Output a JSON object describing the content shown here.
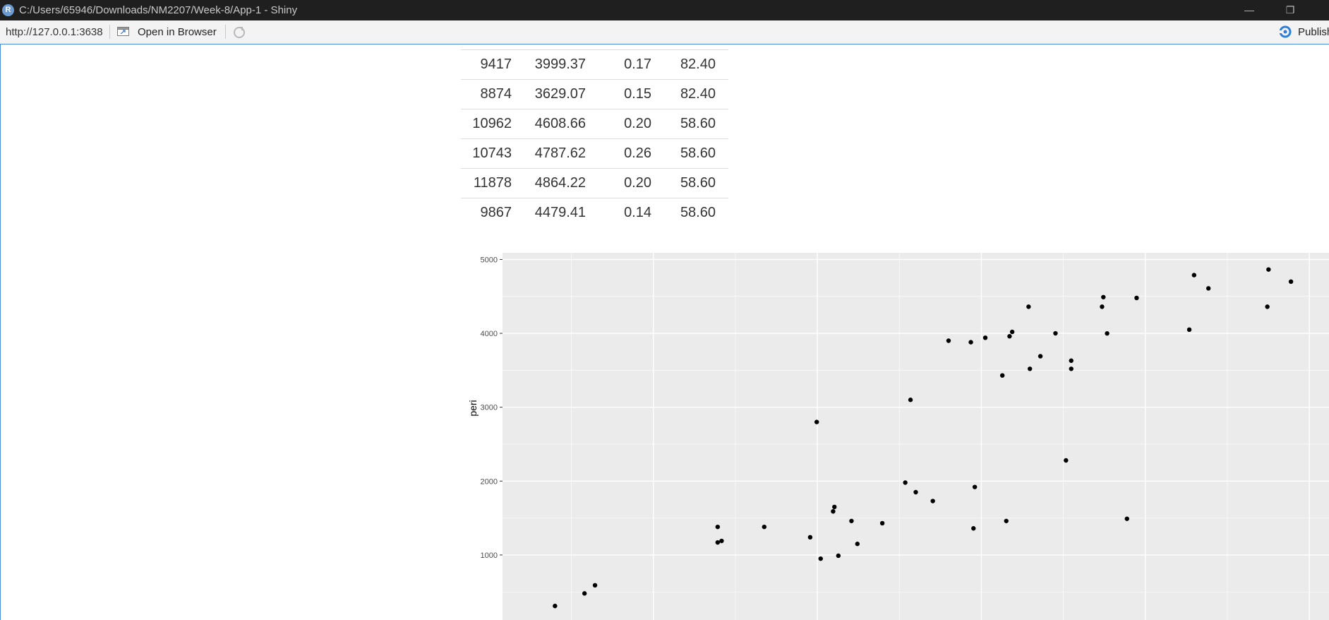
{
  "window": {
    "icon_letter": "R",
    "title": "C:/Users/65946/Downloads/NM2207/Week-8/App-1 - Shiny",
    "minimize": "—",
    "restore": "❐"
  },
  "toolbar": {
    "url": "http://127.0.0.1:3638",
    "open_in_browser": "Open in Browser",
    "publish": "Publish"
  },
  "table": {
    "rows": [
      [
        "9417",
        "3999.37",
        "0.17",
        "82.40"
      ],
      [
        "8874",
        "3629.07",
        "0.15",
        "82.40"
      ],
      [
        "10962",
        "4608.66",
        "0.20",
        "58.60"
      ],
      [
        "10743",
        "4787.62",
        "0.26",
        "58.60"
      ],
      [
        "11878",
        "4864.22",
        "0.20",
        "58.60"
      ],
      [
        "9867",
        "4479.41",
        "0.14",
        "58.60"
      ]
    ]
  },
  "chart_data": {
    "type": "scatter",
    "ylabel": "peri",
    "xlabel": "",
    "xlim": [
      200,
      12800
    ],
    "ylim": [
      120,
      5090
    ],
    "xticks": [
      2500,
      5000,
      7500,
      10000,
      12500
    ],
    "yticks": [
      1000,
      2000,
      3000,
      4000,
      5000
    ],
    "grid": true,
    "background_color": "#ebebeb",
    "point_color": "#000000",
    "points": [
      [
        1000,
        310
      ],
      [
        1450,
        480
      ],
      [
        1610,
        590
      ],
      [
        3480,
        1380
      ],
      [
        3480,
        1170
      ],
      [
        3540,
        1190
      ],
      [
        4190,
        1380
      ],
      [
        4890,
        1240
      ],
      [
        4990,
        2800
      ],
      [
        5050,
        950
      ],
      [
        5240,
        1590
      ],
      [
        5260,
        1650
      ],
      [
        5320,
        990
      ],
      [
        5520,
        1460
      ],
      [
        5610,
        1150
      ],
      [
        5990,
        1430
      ],
      [
        6340,
        1980
      ],
      [
        6420,
        3100
      ],
      [
        6500,
        1850
      ],
      [
        6760,
        1730
      ],
      [
        7000,
        3900
      ],
      [
        7340,
        3880
      ],
      [
        7380,
        1360
      ],
      [
        7400,
        1920
      ],
      [
        7560,
        3940
      ],
      [
        7820,
        3430
      ],
      [
        7880,
        1460
      ],
      [
        7930,
        3960
      ],
      [
        7970,
        4020
      ],
      [
        8220,
        4360
      ],
      [
        8240,
        3520
      ],
      [
        8400,
        3690
      ],
      [
        8630,
        4000
      ],
      [
        8790,
        2280
      ],
      [
        8870,
        3630
      ],
      [
        8870,
        3520
      ],
      [
        9340,
        4360
      ],
      [
        9360,
        4490
      ],
      [
        9417,
        3999
      ],
      [
        9720,
        1490
      ],
      [
        9867,
        4479
      ],
      [
        10670,
        4050
      ],
      [
        10743,
        4788
      ],
      [
        10962,
        4609
      ],
      [
        11860,
        4360
      ],
      [
        11878,
        4864
      ],
      [
        12220,
        4700
      ]
    ]
  }
}
